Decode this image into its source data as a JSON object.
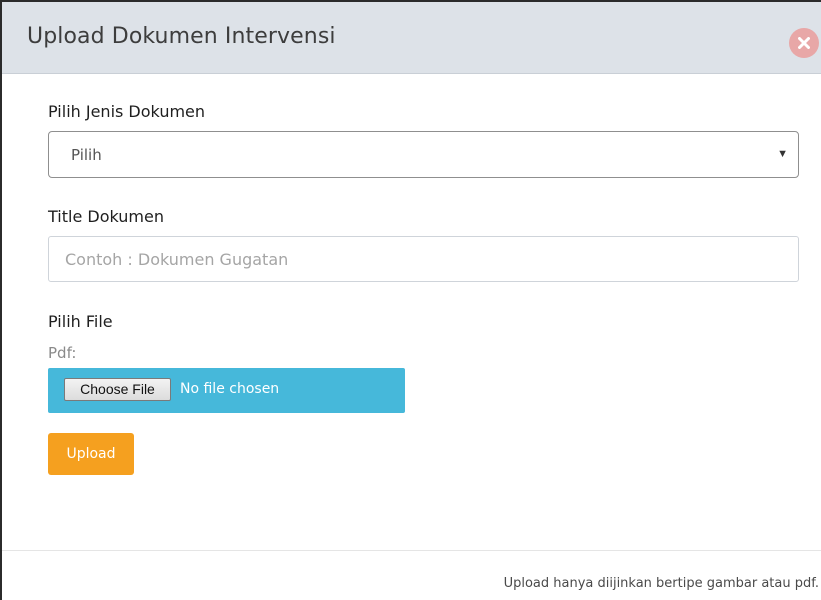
{
  "modal": {
    "title": "Upload Dokumen Intervensi",
    "close_icon": "close-circle-icon",
    "close_color": "#e8a7a7"
  },
  "form": {
    "document_type": {
      "label": "Pilih Jenis Dokumen",
      "selected": "Pilih",
      "arrow_icon": "caret-down-icon"
    },
    "title": {
      "label": "Title Dokumen",
      "value": "",
      "placeholder": "Contoh : Dokumen Gugatan"
    },
    "file": {
      "label": "Pilih File",
      "type_label": "Pdf:",
      "button_label": "Choose File",
      "status": "No file chosen",
      "bar_color": "#46b8da"
    },
    "submit": {
      "label": "Upload",
      "color": "#f5a01f"
    }
  },
  "footer": {
    "note": "Upload hanya diijinkan bertipe gambar atau pdf."
  }
}
